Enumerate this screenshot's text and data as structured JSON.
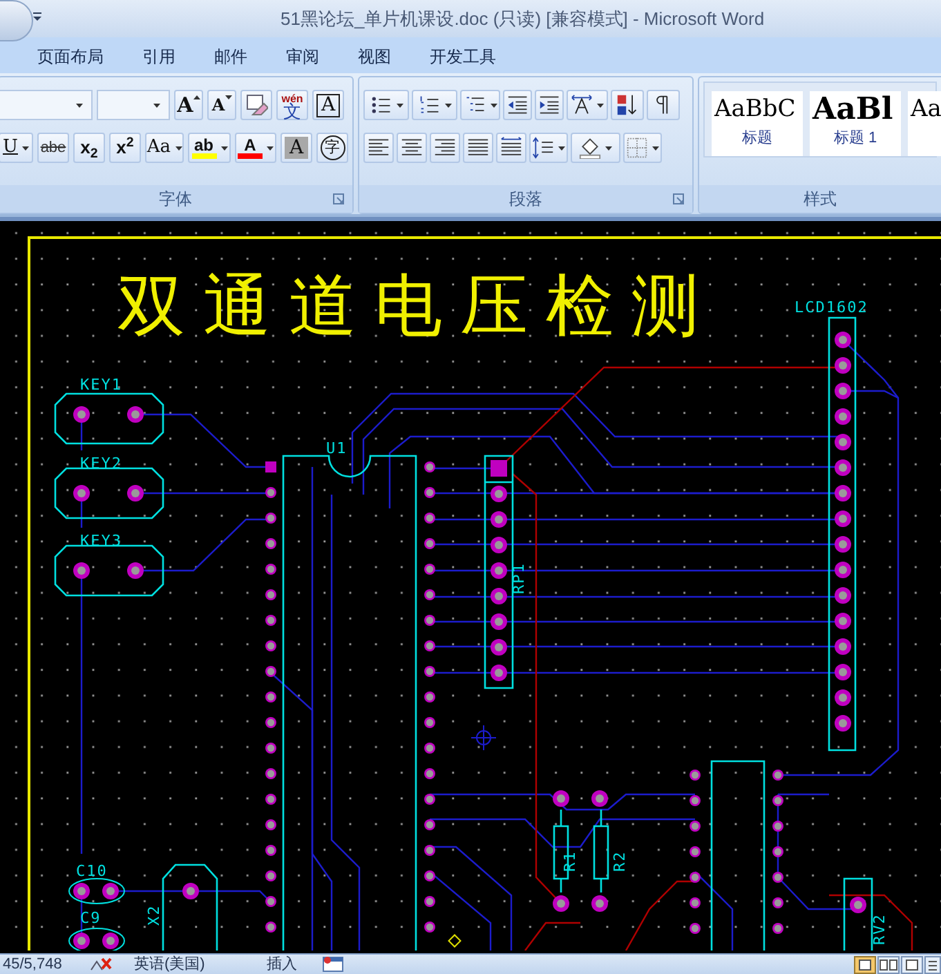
{
  "title_bar": {
    "title": "51黑论坛_单片机课设.doc (只读) [兼容模式] - Microsoft Word"
  },
  "tabs": [
    {
      "label": "页面布局",
      "selected": false
    },
    {
      "label": "引用",
      "selected": false
    },
    {
      "label": "邮件",
      "selected": false
    },
    {
      "label": "审阅",
      "selected": false
    },
    {
      "label": "视图",
      "selected": false
    },
    {
      "label": "开发工具",
      "selected": false
    }
  ],
  "font_group": {
    "label": "字体",
    "row_1": [
      {
        "kind": "grow",
        "text": "A"
      },
      {
        "kind": "shrink",
        "text": "A"
      },
      {
        "kind": "clear"
      },
      {
        "kind": "phonetic",
        "text": "文",
        "ruby": "wén"
      },
      {
        "kind": "boxed",
        "text": "A"
      }
    ],
    "row_2": [
      {
        "kind": "dropdown",
        "text": "U"
      },
      {
        "kind": "strike",
        "text": "abe"
      },
      {
        "kind": "plain",
        "text": "x$_{2}$"
      },
      {
        "kind": "plain",
        "text": "x$^{2}$"
      },
      {
        "kind": "dropdown",
        "text": "Aa"
      },
      {
        "kind": "colorbar",
        "text": "ab",
        "color": "#ffff00"
      },
      {
        "kind": "colorbar",
        "text": "A",
        "color": "#ff0000"
      },
      {
        "kind": "shaded",
        "text": "A"
      },
      {
        "kind": "circled",
        "text": "字"
      }
    ]
  },
  "paragraph_group": {
    "label": "段落",
    "row_1": [
      {
        "kind": "bullets"
      },
      {
        "kind": "numbering"
      },
      {
        "kind": "multilevel"
      },
      {
        "kind": "outdent"
      },
      {
        "kind": "indent"
      },
      {
        "kind": "direction"
      },
      {
        "kind": "sort"
      },
      {
        "kind": "marks"
      }
    ],
    "row_2": [
      {
        "kind": "left"
      },
      {
        "kind": "center"
      },
      {
        "kind": "right"
      },
      {
        "kind": "justify"
      },
      {
        "kind": "distribute"
      },
      {
        "kind": "spacing"
      },
      {
        "kind": "fill"
      },
      {
        "kind": "borders"
      }
    ]
  },
  "styles_group": {
    "label": "样式",
    "styles": [
      {
        "preview": "AaBbC",
        "label": "标题"
      },
      {
        "preview": "AaBl",
        "label": "标题 1"
      },
      {
        "preview": "Aa"
      }
    ]
  },
  "pcb": {
    "title": "双通道电压检测",
    "labels": [
      {
        "text": "KEY1"
      },
      {
        "text": "KEY2"
      },
      {
        "text": "KEY3"
      },
      {
        "text": "U1"
      },
      {
        "text": "RP1"
      },
      {
        "text": "LCD1602"
      },
      {
        "text": "R1"
      },
      {
        "text": "R2"
      },
      {
        "text": "C10"
      },
      {
        "text": "C9"
      },
      {
        "text": "X2"
      },
      {
        "text": "RV2"
      }
    ]
  },
  "status_bar": {
    "page": "45/5,748",
    "language": "英语(美国)",
    "mode": "插入"
  }
}
